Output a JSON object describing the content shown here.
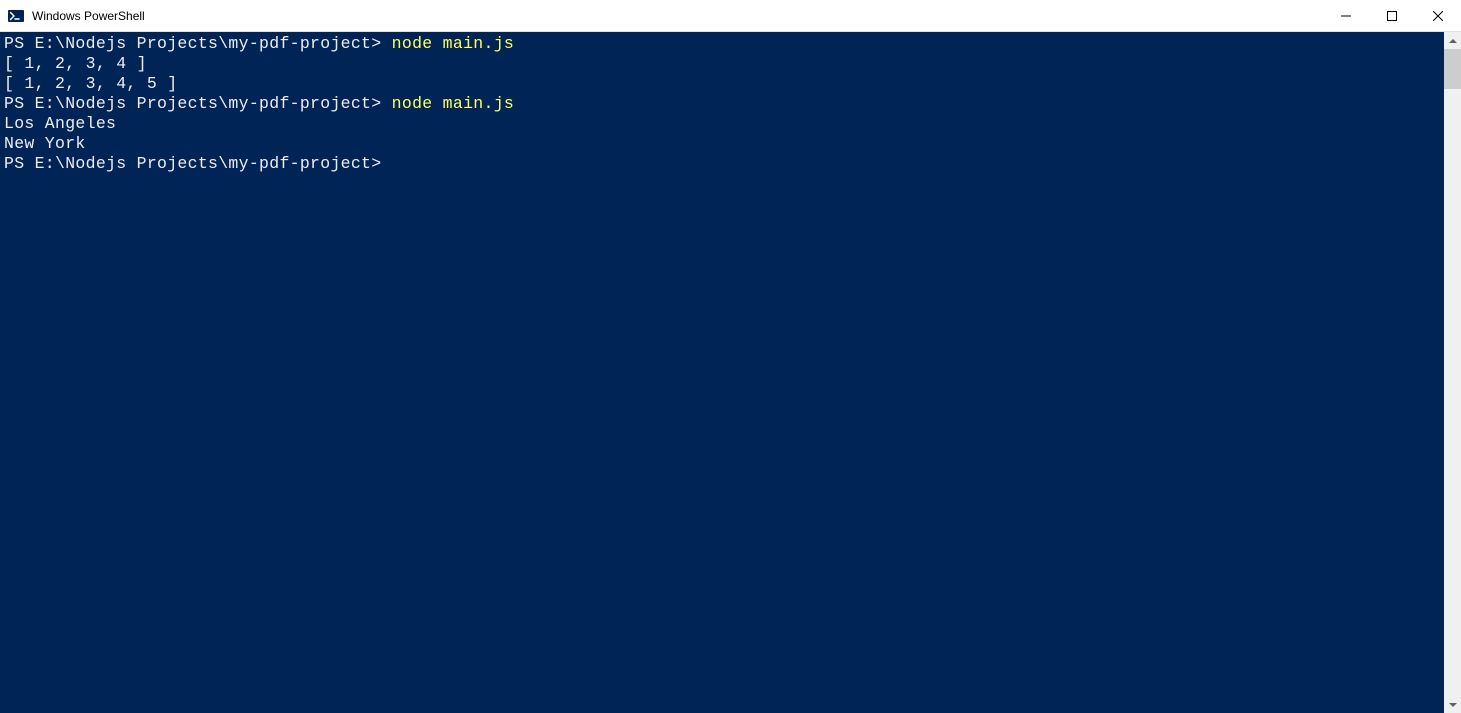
{
  "window": {
    "title": "Windows PowerShell"
  },
  "terminal": {
    "lines": [
      {
        "prompt": "PS E:\\Nodejs Projects\\my-pdf-project> ",
        "command": "node main.js"
      },
      {
        "output": "[ 1, 2, 3, 4 ]"
      },
      {
        "output": "[ 1, 2, 3, 4, 5 ]"
      },
      {
        "prompt": "PS E:\\Nodejs Projects\\my-pdf-project> ",
        "command": "node main.js"
      },
      {
        "output": "Los Angeles"
      },
      {
        "output": "New York"
      },
      {
        "prompt": "PS E:\\Nodejs Projects\\my-pdf-project>",
        "command": ""
      }
    ]
  },
  "colors": {
    "terminal_bg": "#012456",
    "terminal_fg": "#eeedf0",
    "command_fg": "#ffff60"
  }
}
